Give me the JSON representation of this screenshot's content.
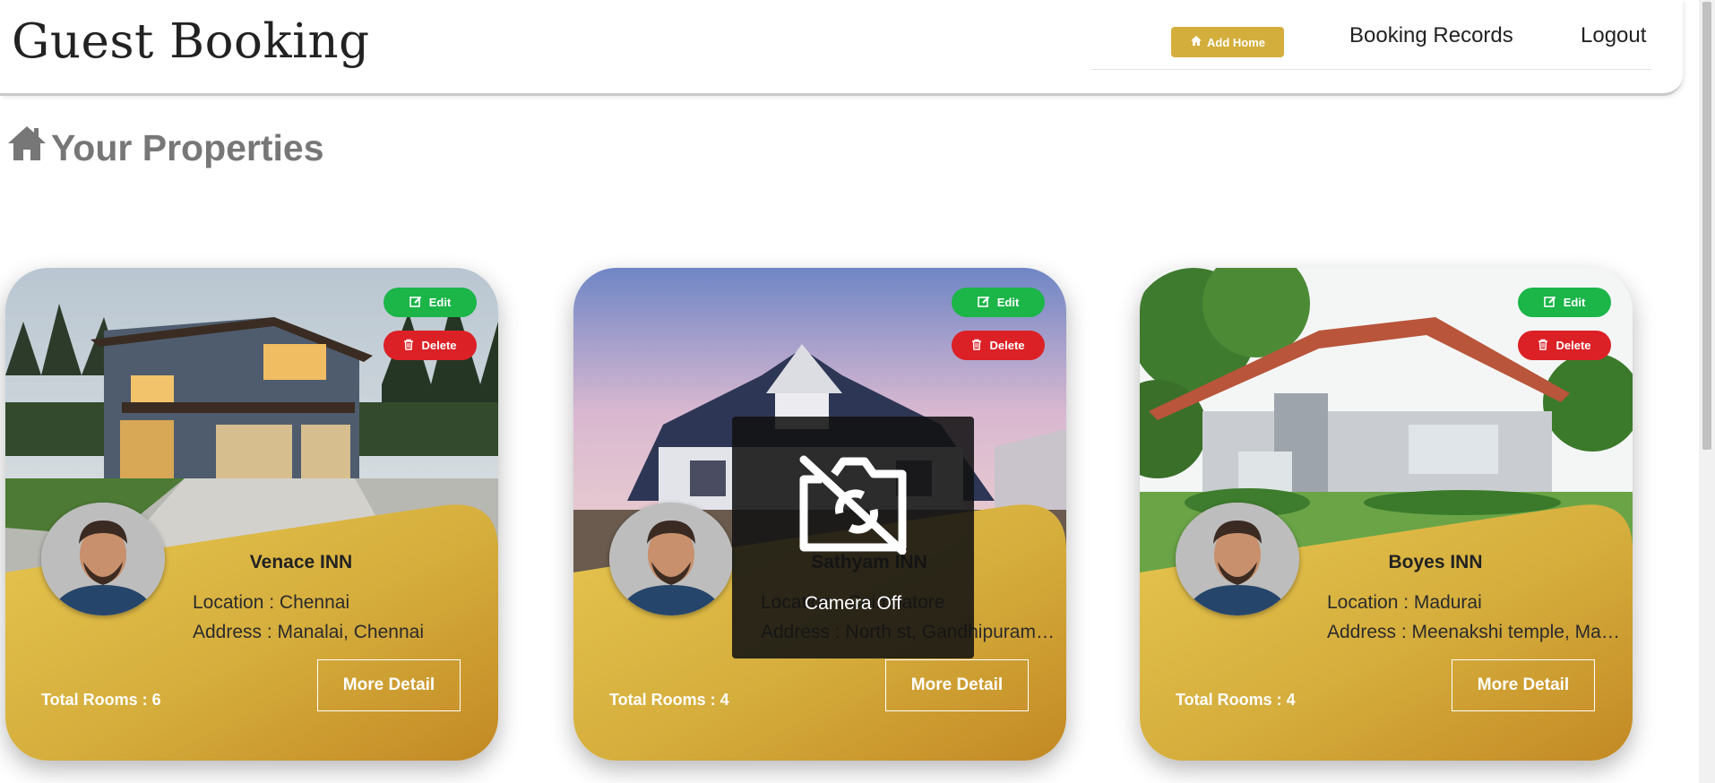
{
  "header": {
    "brand": "Guest Booking",
    "add_home_label": "Add Home",
    "nav_records": "Booking Records",
    "nav_logout": "Logout"
  },
  "page": {
    "title": "Your Properties"
  },
  "cards": [
    {
      "edit_label": "Edit",
      "delete_label": "Delete",
      "name": "Venace INN",
      "location": "Location : Chennai",
      "address": "Address : Manalai, Chennai",
      "rooms": "Total Rooms : 6",
      "more_label": "More Detail"
    },
    {
      "edit_label": "Edit",
      "delete_label": "Delete",
      "name": "Sathyam INN",
      "location": "Location : Coimbatore",
      "address": "Address : North st, Gandhipuram, Coimbatore",
      "rooms": "Total Rooms : 4",
      "more_label": "More Detail"
    },
    {
      "edit_label": "Edit",
      "delete_label": "Delete",
      "name": "Boyes INN",
      "location": "Location : Madurai",
      "address": "Address : Meenakshi temple, Madurai",
      "rooms": "Total Rooms : 4",
      "more_label": "More Detail"
    }
  ],
  "overlay": {
    "camera_label": "Camera Off"
  },
  "colors": {
    "gold": "#d4ae3c",
    "edit": "#1bb548",
    "delete": "#dc2126"
  },
  "icons": {
    "add_home": "home-icon",
    "title": "home-icon",
    "edit": "edit-icon",
    "delete": "trash-icon",
    "camera": "camera-off-icon"
  }
}
